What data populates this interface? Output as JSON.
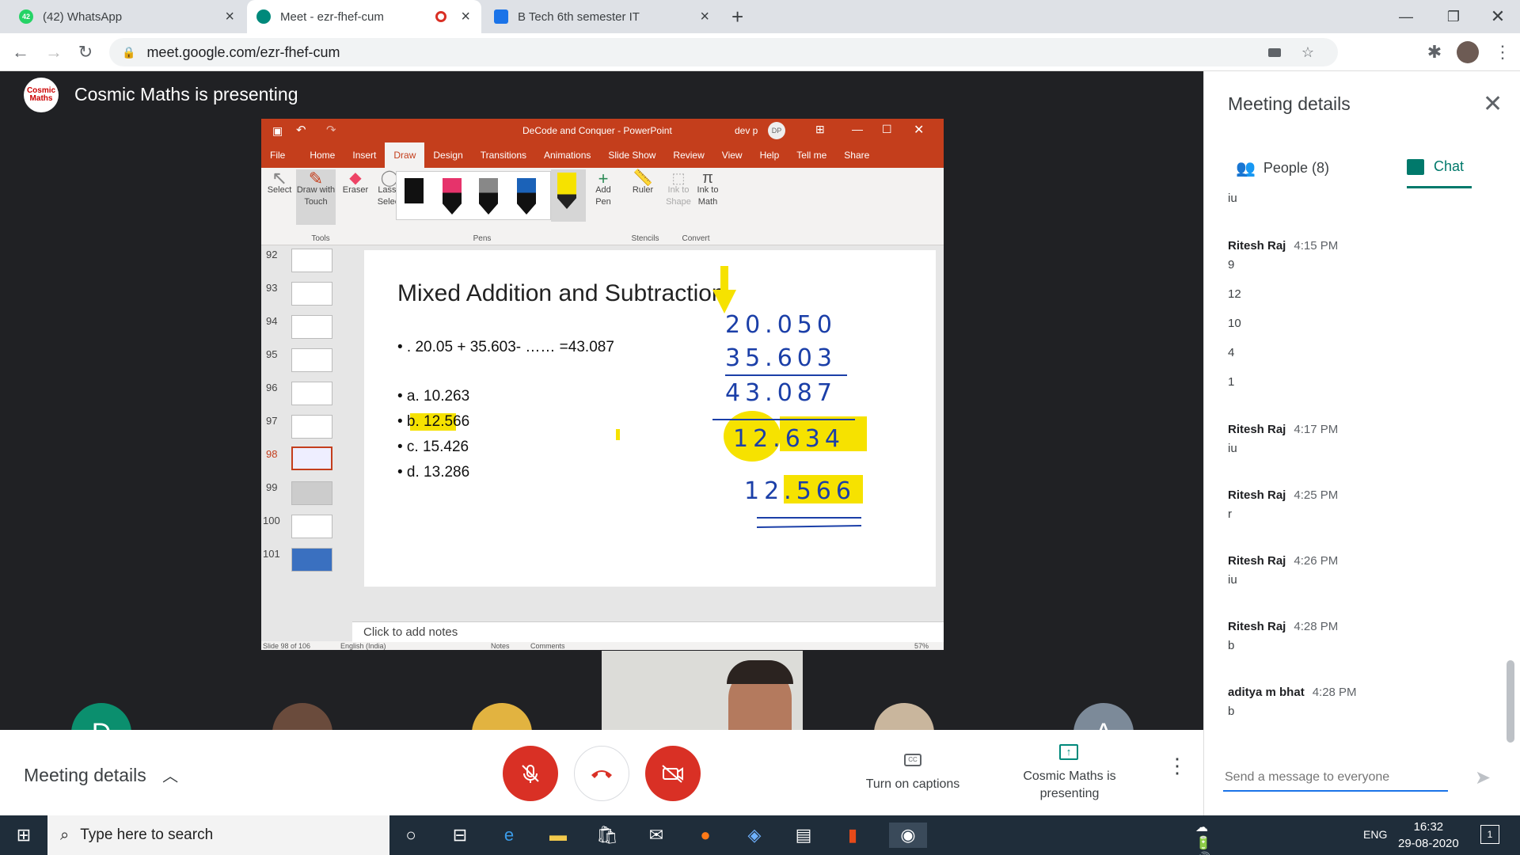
{
  "browser": {
    "tabs": [
      {
        "title": "(42) WhatsApp",
        "badge": "42"
      },
      {
        "title": "Meet - ezr-fhef-cum"
      },
      {
        "title": "B Tech 6th semester IT"
      }
    ],
    "url": "meet.google.com/ezr-fhef-cum"
  },
  "meet": {
    "presenter_logo": "Cosmic Maths",
    "presenting_title": "Cosmic Maths is presenting"
  },
  "ppt": {
    "window_title": "DeCode and Conquer  -  PowerPoint",
    "user": "dev p",
    "user_initials": "DP",
    "menu": [
      "File",
      "Home",
      "Insert",
      "Draw",
      "Design",
      "Transitions",
      "Animations",
      "Slide Show",
      "Review",
      "View",
      "Help",
      "Tell me",
      "Share"
    ],
    "selected_menu": "Draw",
    "ribbon": {
      "select": "Select",
      "draw_touch": "Draw with Touch",
      "eraser": "Eraser",
      "lasso": "Lasso Select",
      "add_pen": "Add Pen",
      "ruler": "Ruler",
      "ink_shape": "Ink to Shape",
      "ink_math": "Ink to Math",
      "groups": [
        "Tools",
        "Pens",
        "Stencils",
        "Convert"
      ]
    },
    "thumbnail_numbers": [
      "92",
      "93",
      "94",
      "95",
      "96",
      "97",
      "98",
      "99",
      "100",
      "101"
    ],
    "current_slide": "98",
    "slide": {
      "title": "Mixed Addition and Subtraction",
      "question": "• . 20.05 + 35.603- …… =43.087",
      "options": [
        "• a. 10.263",
        "• b. 12.566",
        "• c. 15.426",
        "• d. 13.286"
      ],
      "handwriting": [
        "20.050",
        "35.603",
        "43.087",
        "12.634",
        "12.566"
      ]
    },
    "notes_placeholder": "Click to add notes",
    "status": {
      "slide_of": "Slide 98 of 106",
      "language": "English (India)",
      "notes": "Notes",
      "comments": "Comments",
      "zoom": "57%"
    }
  },
  "controls": {
    "meeting_details": "Meeting details",
    "captions": "Turn on captions",
    "presenting": "Cosmic Maths is presenting",
    "participant_initials": [
      "D",
      "A"
    ]
  },
  "panel": {
    "title": "Meeting details",
    "tabs": {
      "people": "People (8)",
      "chat": "Chat"
    },
    "messages": [
      {
        "sender": "",
        "time": "",
        "lines": [
          "iu"
        ]
      },
      {
        "sender": "Ritesh Raj",
        "time": "4:15 PM",
        "lines": [
          "9",
          "12",
          "10",
          "4",
          "1"
        ]
      },
      {
        "sender": "Ritesh Raj",
        "time": "4:17 PM",
        "lines": [
          "iu"
        ]
      },
      {
        "sender": "Ritesh Raj",
        "time": "4:25 PM",
        "lines": [
          "r"
        ]
      },
      {
        "sender": "Ritesh Raj",
        "time": "4:26 PM",
        "lines": [
          "iu"
        ]
      },
      {
        "sender": "Ritesh Raj",
        "time": "4:28 PM",
        "lines": [
          "b"
        ]
      },
      {
        "sender": "aditya m bhat",
        "time": "4:28 PM",
        "lines": [
          "b"
        ]
      }
    ],
    "input_placeholder": "Send a message to everyone"
  },
  "taskbar": {
    "search_placeholder": "Type here to search",
    "language": "ENG",
    "time": "16:32",
    "date": "29-08-2020",
    "notification_count": "1"
  },
  "colors": {
    "ppt_accent": "#c43e1c",
    "meet_red": "#d93025",
    "meet_blue": "#1a73e8",
    "highlighter": "#f6e200",
    "ink": "#1b3fa8"
  }
}
